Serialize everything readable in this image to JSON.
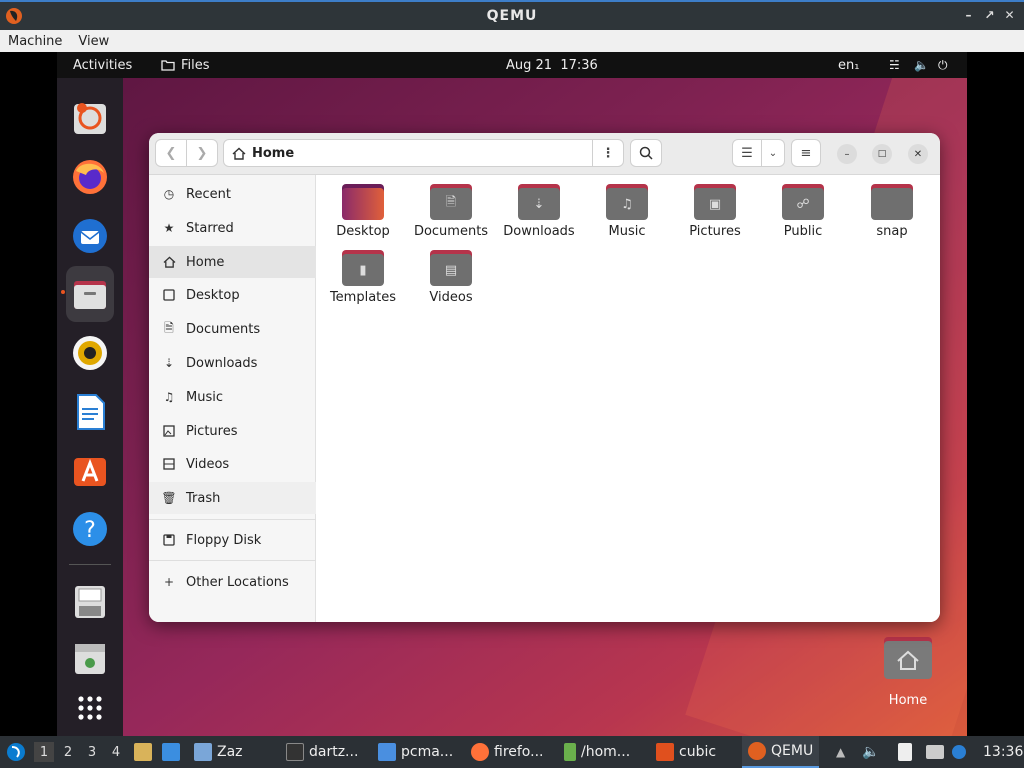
{
  "qemu": {
    "title": "QEMU",
    "menu": [
      "Machine",
      "View"
    ]
  },
  "gnome_top": {
    "activities": "Activities",
    "app": "Files",
    "date": "Aug 21",
    "time": "17:36",
    "lang": "en₁"
  },
  "files": {
    "location": "Home",
    "sidebar": [
      {
        "label": "Recent",
        "icon": "clock-icon"
      },
      {
        "label": "Starred",
        "icon": "star-icon"
      },
      {
        "label": "Home",
        "icon": "home-icon"
      },
      {
        "label": "Desktop",
        "icon": "desktop-icon"
      },
      {
        "label": "Documents",
        "icon": "document-icon"
      },
      {
        "label": "Downloads",
        "icon": "download-icon"
      },
      {
        "label": "Music",
        "icon": "music-icon"
      },
      {
        "label": "Pictures",
        "icon": "picture-icon"
      },
      {
        "label": "Videos",
        "icon": "video-icon"
      },
      {
        "label": "Trash",
        "icon": "trash-icon"
      },
      {
        "label": "Floppy Disk",
        "icon": "floppy-icon"
      },
      {
        "label": "Other Locations",
        "icon": "plus-icon"
      }
    ],
    "folders": [
      {
        "label": "Desktop"
      },
      {
        "label": "Documents"
      },
      {
        "label": "Downloads"
      },
      {
        "label": "Music"
      },
      {
        "label": "Pictures"
      },
      {
        "label": "Public"
      },
      {
        "label": "snap"
      },
      {
        "label": "Templates"
      },
      {
        "label": "Videos"
      }
    ]
  },
  "desktop_icon": {
    "label": "Home"
  },
  "taskbar": {
    "workspaces": [
      "1",
      "2",
      "3",
      "4"
    ],
    "tasks": [
      "Zaz",
      "dartz...",
      "pcma...",
      "firefo...",
      "/hom...",
      "cubic",
      "QEMU"
    ],
    "clock": "13:36"
  },
  "colors": {
    "accent": "#e95420",
    "folder_tab": "#b5334a",
    "folder_body": "#6f6f6f"
  }
}
